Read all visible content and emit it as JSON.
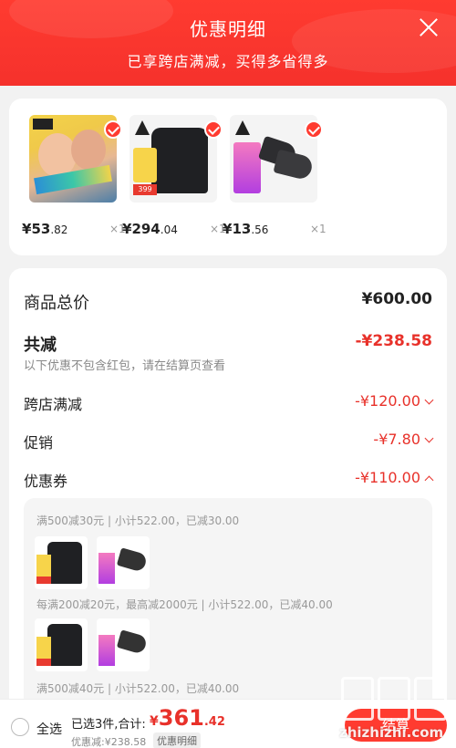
{
  "header": {
    "title": "优惠明细",
    "subtitle": "已享跨店满减，买得多省得多"
  },
  "products": [
    {
      "price_symbol": "¥",
      "price_int": "53",
      "price_dec": ".82",
      "qty": "×1"
    },
    {
      "price_symbol": "¥",
      "price_int": "294",
      "price_dec": ".04",
      "qty": "×1"
    },
    {
      "price_symbol": "¥",
      "price_int": "13",
      "price_dec": ".56",
      "qty": "×1"
    }
  ],
  "summary": {
    "total_label": "商品总价",
    "total_value": "¥600.00",
    "reduce_label": "共减",
    "reduce_value": "-¥238.58",
    "note": "以下优惠不包含红包，请在结算页查看",
    "items": [
      {
        "label": "跨店满减",
        "value": "-¥120.00"
      },
      {
        "label": "促销",
        "value": "-¥7.80"
      },
      {
        "label": "优惠券",
        "value": "-¥110.00"
      }
    ]
  },
  "coupons": [
    {
      "text": "满500减30元 | 小计522.00，已减30.00"
    },
    {
      "text": "每满200减20元，最高减2000元 | 小计522.00，已减40.00"
    },
    {
      "text": "满500减40元 | 小计522.00，已减40.00"
    }
  ],
  "bottombar": {
    "select_all": "全选",
    "selected_info": "已选3件,合计:",
    "total_symbol": "¥",
    "total_int": "361",
    "total_dec": ".42",
    "reduced": "优惠减:¥238.58",
    "detail_tag": "优惠明细",
    "checkout": "结算"
  },
  "watermark": {
    "text": "zhizhizhi.com"
  },
  "colors": {
    "brand_red": "#e8312a",
    "header_red": "#ff3b30"
  }
}
